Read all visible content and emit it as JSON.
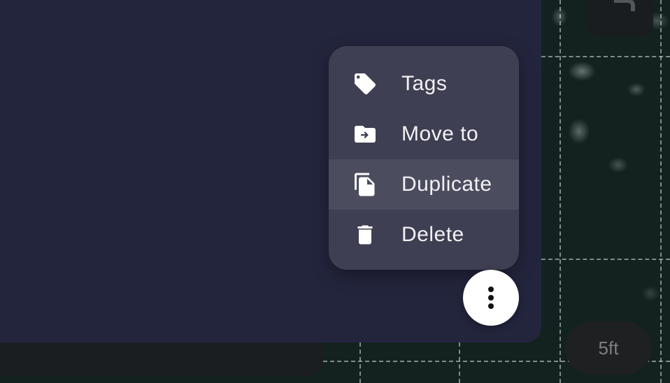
{
  "context_menu": {
    "items": [
      {
        "label": "Tags",
        "icon": "tag-icon",
        "highlighted": false
      },
      {
        "label": "Move to",
        "icon": "folder-move-icon",
        "highlighted": false
      },
      {
        "label": "Duplicate",
        "icon": "duplicate-icon",
        "highlighted": true
      },
      {
        "label": "Delete",
        "icon": "trash-icon",
        "highlighted": false
      }
    ]
  },
  "more_button": {
    "icon": "more-vertical-icon"
  },
  "map": {
    "scale_label": "5ft",
    "top_right_button_icon": "redo-icon"
  },
  "colors": {
    "card_background": "#23253d",
    "menu_background": "#3e3f52",
    "menu_highlight": "#4b4c5e",
    "menu_text": "#f1f1f4",
    "fab_background": "#ffffff",
    "map_background": "#13221f"
  }
}
